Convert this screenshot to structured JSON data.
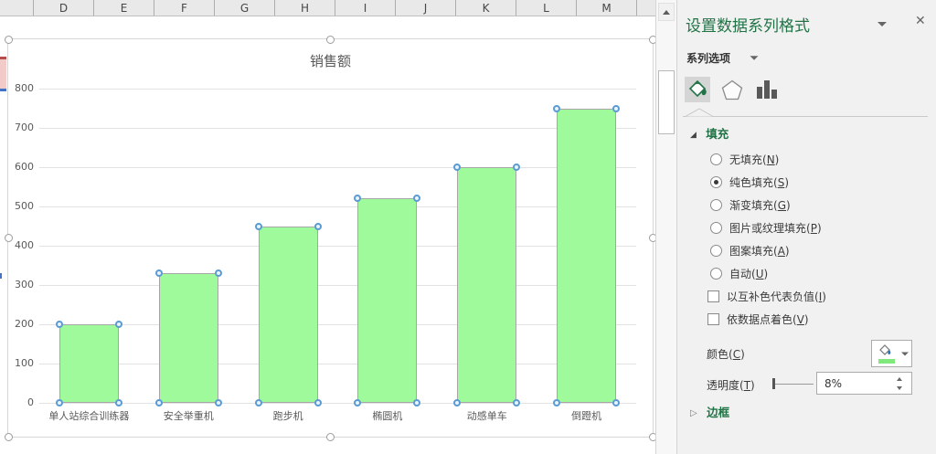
{
  "columns": [
    "D",
    "E",
    "F",
    "G",
    "H",
    "I",
    "J",
    "K",
    "L",
    "M"
  ],
  "chart_data": {
    "type": "bar",
    "title": "销售额",
    "categories": [
      "单人站综合训练器",
      "安全举重机",
      "跑步机",
      "椭圆机",
      "动感单车",
      "倒蹬机"
    ],
    "values": [
      200,
      330,
      450,
      520,
      600,
      750
    ],
    "xlabel": "",
    "ylabel": "",
    "ylim": [
      0,
      800
    ],
    "ytick_step": 100,
    "grid": true,
    "legend": false,
    "selected": true
  },
  "panel": {
    "title": "设置数据系列格式",
    "series_options_label": "系列选项",
    "tabs": [
      {
        "name": "fill-line",
        "icon": "paint-bucket-icon",
        "selected": true
      },
      {
        "name": "effects",
        "icon": "pentagon-icon",
        "selected": false
      },
      {
        "name": "series-options",
        "icon": "bar-chart-icon",
        "selected": false
      }
    ],
    "fill": {
      "header": "填充",
      "expanded": true,
      "radio_options": [
        {
          "label": "无填充(N)",
          "selected": false
        },
        {
          "label": "纯色填充(S)",
          "selected": true
        },
        {
          "label": "渐变填充(G)",
          "selected": false
        },
        {
          "label": "图片或纹理填充(P)",
          "selected": false
        },
        {
          "label": "图案填充(A)",
          "selected": false
        },
        {
          "label": "自动(U)",
          "selected": false
        }
      ],
      "checkbox_options": [
        {
          "label": "以互补色代表负值(I)",
          "checked": false
        },
        {
          "label": "依数据点着色(V)",
          "checked": false
        }
      ],
      "color_label": "颜色(C)",
      "transparency_label": "透明度(T)",
      "transparency_value": "8%"
    },
    "border": {
      "header": "边框",
      "expanded": false
    },
    "icons": {
      "dropdown": "▼",
      "close": "✕",
      "scroll-up": "▲",
      "expanded-marker": "◢",
      "collapsed-marker": "▷"
    }
  },
  "colors": {
    "accent_green": "#217346",
    "bar_fill": "#9EFA9B",
    "bar_border": "#A6A6A6",
    "datapoint_handle_blue": "#5B9BD5",
    "current_fill_swatch": "#7FE97C"
  }
}
